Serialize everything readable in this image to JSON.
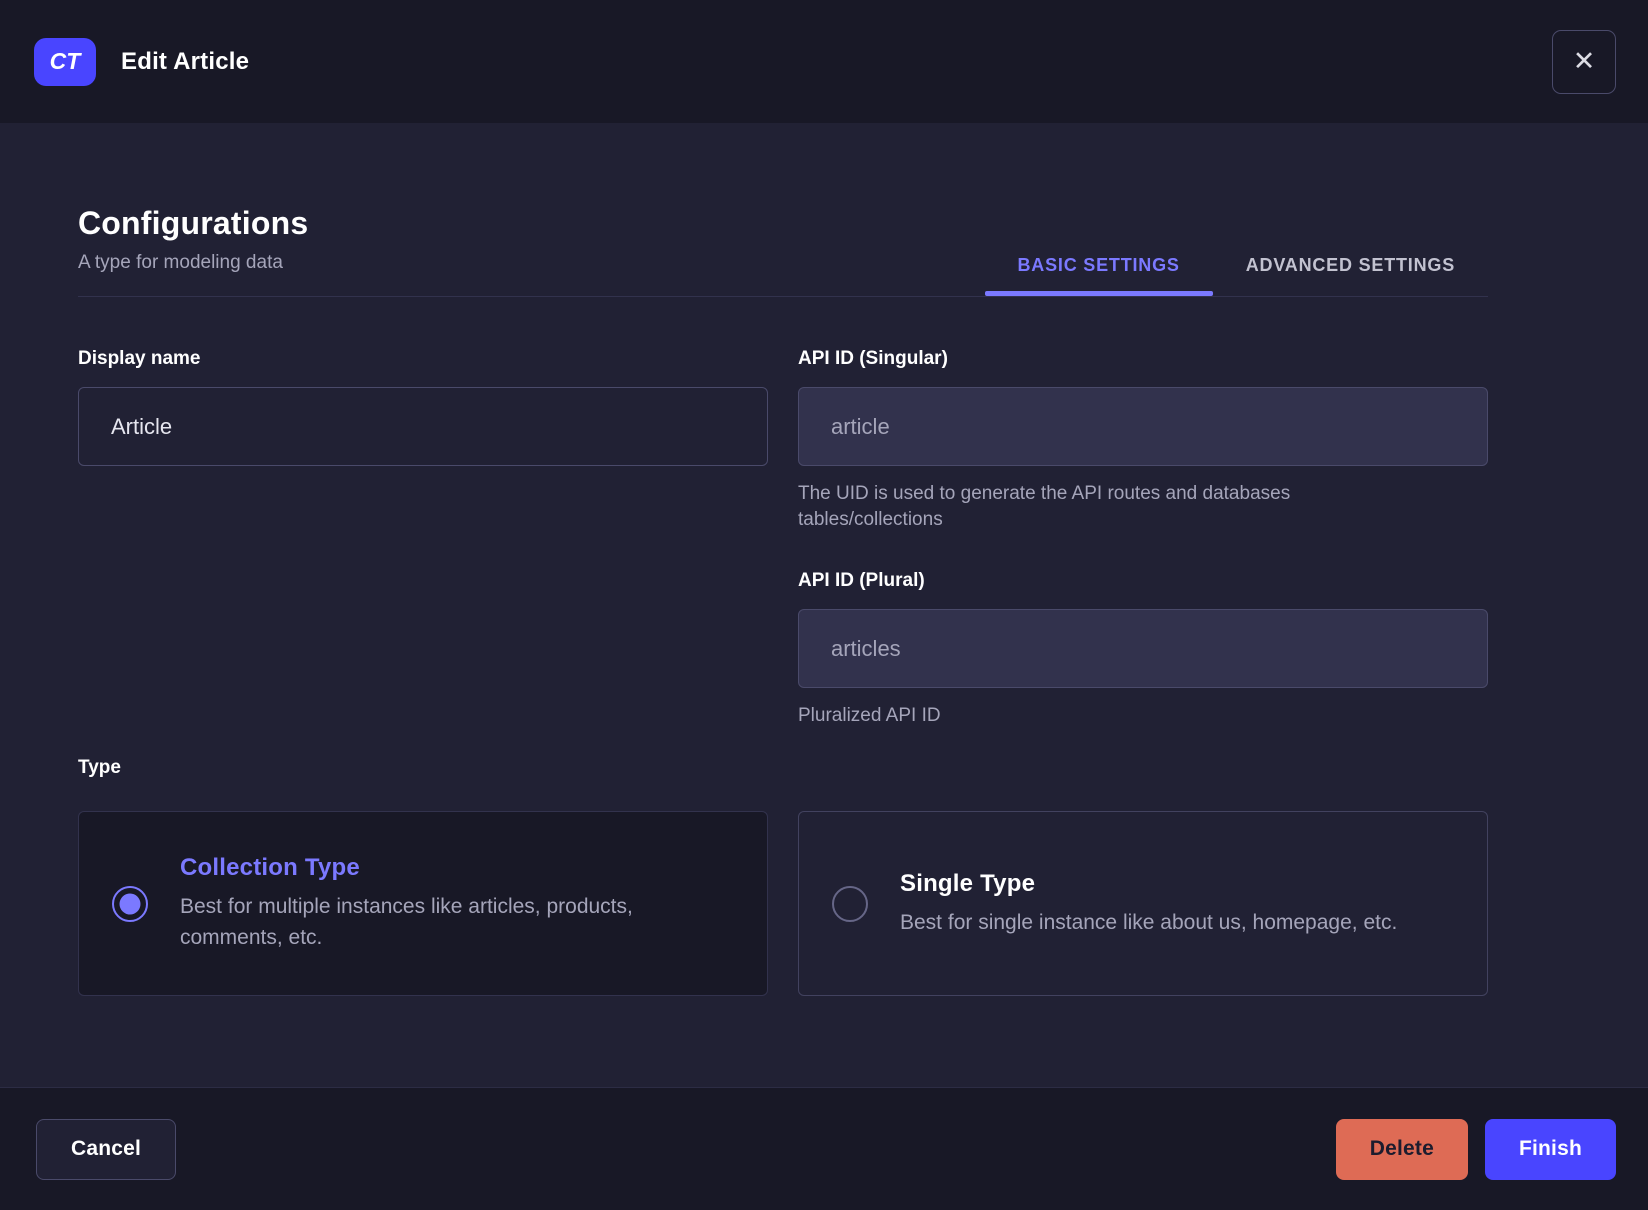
{
  "header": {
    "badge": "CT",
    "title": "Edit Article",
    "close_glyph": "✕"
  },
  "config": {
    "title": "Configurations",
    "subtitle": "A type for modeling data",
    "tabs": [
      {
        "label": "BASIC SETTINGS",
        "active": true
      },
      {
        "label": "ADVANCED SETTINGS",
        "active": false
      }
    ]
  },
  "fields": {
    "display_name": {
      "label": "Display name",
      "value": "Article"
    },
    "api_id_singular": {
      "label": "API ID (Singular)",
      "placeholder": "article",
      "helper": "The UID is used to generate the API routes and databases tables/collections"
    },
    "api_id_plural": {
      "label": "API ID (Plural)",
      "placeholder": "articles",
      "helper": "Pluralized API ID"
    }
  },
  "type_section": {
    "label": "Type",
    "options": [
      {
        "title": "Collection Type",
        "description": "Best for multiple instances like articles, products, comments, etc.",
        "selected": true
      },
      {
        "title": "Single Type",
        "description": "Best for single instance like about us, homepage, etc.",
        "selected": false
      }
    ]
  },
  "footer": {
    "cancel_label": "Cancel",
    "delete_label": "Delete",
    "finish_label": "Finish"
  },
  "colors": {
    "accent": "#4945ff",
    "accent_light": "#7b79ff",
    "danger": "#de6b55",
    "background": "#212134",
    "surface_dark": "#181826"
  }
}
